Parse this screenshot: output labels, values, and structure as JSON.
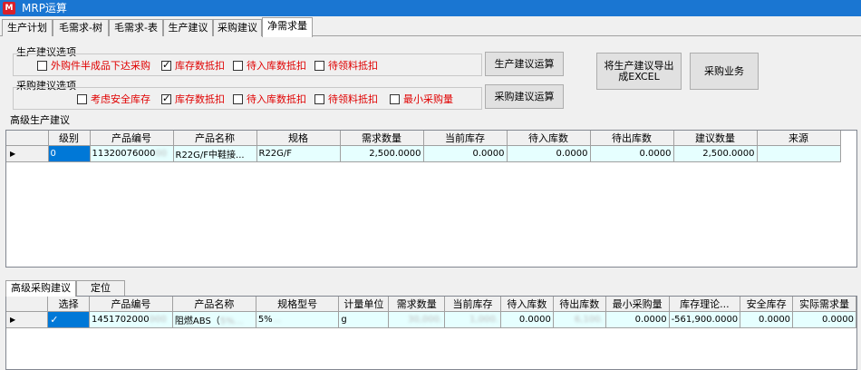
{
  "window": {
    "title": "MRP运算",
    "icon": "app-logo-icon"
  },
  "tabs": [
    {
      "label": "生产计划"
    },
    {
      "label": "毛需求-树"
    },
    {
      "label": "毛需求-表"
    },
    {
      "label": "生产建议"
    },
    {
      "label": "采购建议"
    },
    {
      "label": "净需求量"
    }
  ],
  "production_options": {
    "title": "生产建议选项",
    "options": [
      {
        "label": "外购件半成品下达采购",
        "checked": false
      },
      {
        "label": "库存数抵扣",
        "checked": true
      },
      {
        "label": "待入库数抵扣",
        "checked": false
      },
      {
        "label": "待领料抵扣",
        "checked": false
      }
    ],
    "button": "生产建议运算"
  },
  "purchase_options": {
    "title": "采购建议选项",
    "options": [
      {
        "label": "考虑安全库存",
        "checked": false
      },
      {
        "label": "库存数抵扣",
        "checked": true
      },
      {
        "label": "待入库数抵扣",
        "checked": false
      },
      {
        "label": "待领料抵扣",
        "checked": false
      },
      {
        "label": "最小采购量",
        "checked": false
      }
    ],
    "button": "采购建议运算"
  },
  "export_button": "将生产建议导出成EXCEL",
  "purchase_business_button": "采购业务",
  "production_grid": {
    "title": "高级生产建议",
    "columns": [
      "级别",
      "产品编号",
      "产品名称",
      "规格",
      "需求数量",
      "当前库存",
      "待入库数",
      "待出库数",
      "建议数量",
      "来源"
    ],
    "rows": [
      {
        "marker": "▶",
        "level": "0",
        "code": "11320076000",
        "code_blur": "00",
        "name": "R22G/F中鞋接...",
        "spec": "R22G/F",
        "demand": "2,500.0000",
        "stock": "0.0000",
        "in": "0.0000",
        "out": "0.0000",
        "suggest": "2,500.0000",
        "source": ""
      }
    ]
  },
  "purchase_section": {
    "tabs": [
      {
        "label": "高级采购建议"
      },
      {
        "label": "定位"
      }
    ],
    "columns": [
      "选择",
      "产品编号",
      "产品名称",
      "规格型号",
      "计量单位",
      "需求数量",
      "当前库存",
      "待入库数",
      "待出库数",
      "最小采购量",
      "库存理论...",
      "安全库存",
      "实际需求量"
    ],
    "rows": [
      {
        "marker": "▶",
        "select": "✓",
        "code": "1451702000",
        "code_blur": "000",
        "name": "阻燃ABS（",
        "name_blur": "5%...",
        "spec": "5%",
        "spec_blur": "...",
        "unit": "g",
        "demand": "30,000.",
        "stock": "1,000.",
        "in": "0.0000",
        "out": "6,100.",
        "min": "0.0000",
        "theory": "-561,900.0000",
        "safety": "0.0000",
        "actual": "0.0000"
      }
    ]
  }
}
